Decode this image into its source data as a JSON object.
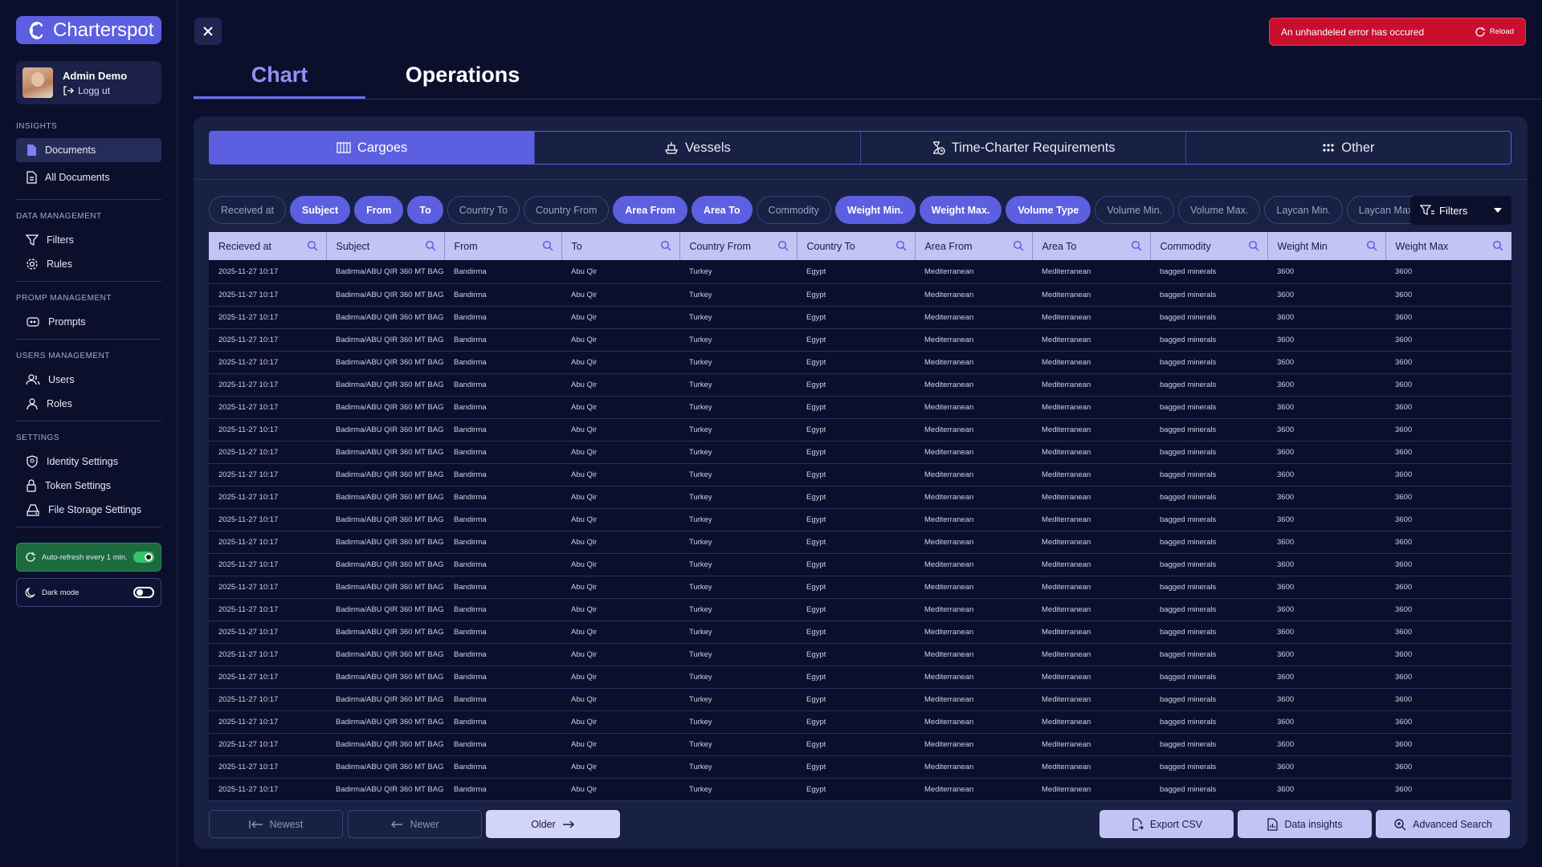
{
  "app": {
    "name": "Charterspot"
  },
  "user": {
    "name": "Admin Demo",
    "logout_label": "Logg ut"
  },
  "sidebar": {
    "sections": [
      {
        "title": "INSIGHTS",
        "items": [
          {
            "label": "Documents",
            "icon": "document-icon",
            "active": true
          },
          {
            "label": "All Documents",
            "icon": "documents-icon"
          }
        ]
      },
      {
        "title": "DATA MANAGEMENT",
        "items": [
          {
            "label": "Filters",
            "icon": "filter-icon"
          },
          {
            "label": "Rules",
            "icon": "gear-icon"
          }
        ]
      },
      {
        "title": "PROMP MANAGEMENT",
        "items": [
          {
            "label": "Prompts",
            "icon": "prompt-icon"
          }
        ]
      },
      {
        "title": "USERS MANAGEMENT",
        "items": [
          {
            "label": "Users",
            "icon": "users-icon"
          },
          {
            "label": "Roles",
            "icon": "role-icon"
          }
        ]
      },
      {
        "title": "SETTINGS",
        "items": [
          {
            "label": "Identity Settings",
            "icon": "shield-icon"
          },
          {
            "label": "Token Settings",
            "icon": "lock-icon"
          },
          {
            "label": "File Storage Settings",
            "icon": "storage-icon"
          }
        ]
      }
    ],
    "auto_refresh_label": "Auto-refresh every 1 min.",
    "auto_refresh_on": true,
    "dark_mode_label": "Dark mode",
    "dark_mode_on": false
  },
  "header": {
    "tabs": [
      {
        "label": "Chart",
        "active": true
      },
      {
        "label": "Operations",
        "active": false
      }
    ],
    "error_text": "An unhandeled error has occured",
    "reload_label": "Reload"
  },
  "category_tabs": [
    {
      "label": "Cargoes",
      "icon": "cargo-icon",
      "active": true
    },
    {
      "label": "Vessels",
      "icon": "vessel-icon",
      "active": false
    },
    {
      "label": "Time-Charter Requirements",
      "icon": "time-charter-icon",
      "active": false
    },
    {
      "label": "Other",
      "icon": "grid-icon",
      "active": false
    }
  ],
  "chips": [
    {
      "label": "Received at",
      "on": false
    },
    {
      "label": "Subject",
      "on": true
    },
    {
      "label": "From",
      "on": true
    },
    {
      "label": "To",
      "on": true
    },
    {
      "label": "Country To",
      "on": false
    },
    {
      "label": "Country From",
      "on": false
    },
    {
      "label": "Area From",
      "on": true
    },
    {
      "label": "Area To",
      "on": true
    },
    {
      "label": "Commodity",
      "on": false
    },
    {
      "label": "Weight Min.",
      "on": true
    },
    {
      "label": "Weight Max.",
      "on": true
    },
    {
      "label": "Volume Type",
      "on": true
    },
    {
      "label": "Volume Min.",
      "on": false
    },
    {
      "label": "Volume Max.",
      "on": false
    },
    {
      "label": "Laycan Min.",
      "on": false
    },
    {
      "label": "Laycan Max.",
      "on": false
    }
  ],
  "filters_label": "Filters",
  "table": {
    "columns": [
      "Recieved at",
      "Subject",
      "From",
      "To",
      "Country From",
      "Country To",
      "Area From",
      "Area To",
      "Commodity",
      "Weight Min",
      "Weight Max"
    ],
    "row_template": [
      "2025-11-27 10:17",
      "Badirma/ABU QIR 360 MT BAG",
      "Bandirma",
      "Abu Qir",
      "Turkey",
      "Egypt",
      "Mediterranean",
      "Mediterranean",
      "bagged minerals",
      "3600",
      "3600"
    ],
    "row_count": 24
  },
  "footer": {
    "newest_label": "Newest",
    "newer_label": "Newer",
    "older_label": "Older",
    "export_label": "Export CSV",
    "insights_label": "Data insights",
    "advanced_label": "Advanced Search"
  },
  "colors": {
    "accent": "#5b5fe0",
    "background": "#0b0f2c",
    "panel": "#182043",
    "error": "#c8102e",
    "toggle_on": "#36c36d"
  }
}
